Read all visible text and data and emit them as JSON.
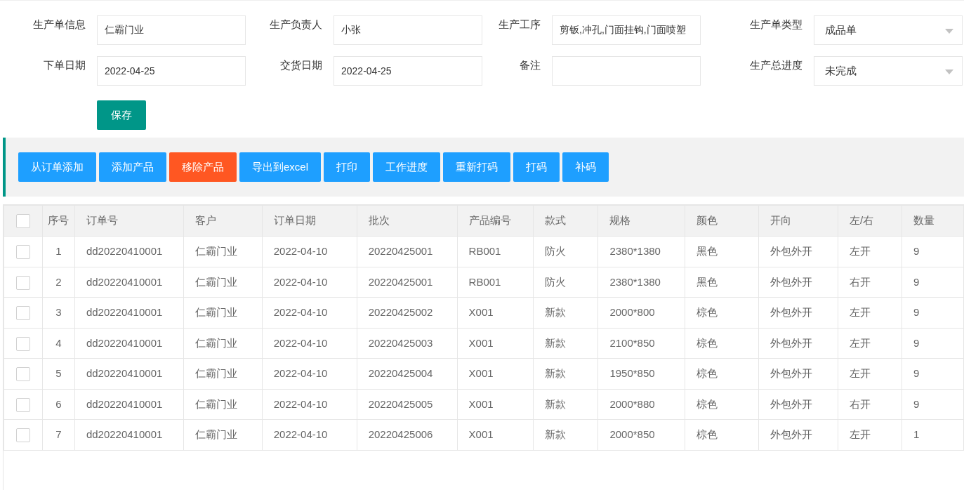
{
  "form": {
    "fields": [
      {
        "label": "生产单信息",
        "kind": "text",
        "value": "仁霸门业"
      },
      {
        "label": "生产负责人",
        "kind": "text",
        "value": "小张"
      },
      {
        "label": "生产工序",
        "kind": "text",
        "value": "剪钣,冲孔,门面挂钩,门面喷塑"
      },
      {
        "label": "生产单类型",
        "kind": "select",
        "value": "成品单"
      },
      {
        "label": "下单日期",
        "kind": "text",
        "value": "2022-04-25"
      },
      {
        "label": "交货日期",
        "kind": "text",
        "value": "2022-04-25"
      },
      {
        "label": "备注",
        "kind": "text"
      },
      {
        "label": "生产总进度",
        "kind": "select",
        "value": "未完成"
      }
    ],
    "save_button": "保存"
  },
  "toolbar": [
    {
      "label": "从订单添加",
      "kind": "normal"
    },
    {
      "label": "添加产品",
      "kind": "normal"
    },
    {
      "label": "移除产品",
      "kind": "danger"
    },
    {
      "label": "导出到excel",
      "kind": "normal"
    },
    {
      "label": "打印",
      "kind": "normal"
    },
    {
      "label": "工作进度",
      "kind": "normal"
    },
    {
      "label": "重新打码",
      "kind": "normal"
    },
    {
      "label": "打码",
      "kind": "normal"
    },
    {
      "label": "补码",
      "kind": "normal"
    }
  ],
  "table": {
    "select_all_checked": false,
    "columns": [
      "序号",
      "订单号",
      "客户",
      "订单日期",
      "批次",
      "产品编号",
      "款式",
      "规格",
      "颜色",
      "开向",
      "左/右",
      "数量"
    ],
    "rows": [
      {
        "checked": false,
        "cells": [
          "1",
          "dd20220410001",
          "仁霸门业",
          "2022-04-10",
          "20220425001",
          "RB001",
          "防火",
          "2380*1380",
          "黑色",
          "外包外开",
          "左开",
          "9"
        ]
      },
      {
        "checked": false,
        "cells": [
          "2",
          "dd20220410001",
          "仁霸门业",
          "2022-04-10",
          "20220425001",
          "RB001",
          "防火",
          "2380*1380",
          "黑色",
          "外包外开",
          "右开",
          "9"
        ]
      },
      {
        "checked": false,
        "cells": [
          "3",
          "dd20220410001",
          "仁霸门业",
          "2022-04-10",
          "20220425002",
          "X001",
          "新款",
          "2000*800",
          "棕色",
          "外包外开",
          "左开",
          "9"
        ]
      },
      {
        "checked": false,
        "cells": [
          "4",
          "dd20220410001",
          "仁霸门业",
          "2022-04-10",
          "20220425003",
          "X001",
          "新款",
          "2100*850",
          "棕色",
          "外包外开",
          "左开",
          "9"
        ]
      },
      {
        "checked": false,
        "cells": [
          "5",
          "dd20220410001",
          "仁霸门业",
          "2022-04-10",
          "20220425004",
          "X001",
          "新款",
          "1950*850",
          "棕色",
          "外包外开",
          "左开",
          "9"
        ]
      },
      {
        "checked": false,
        "cells": [
          "6",
          "dd20220410001",
          "仁霸门业",
          "2022-04-10",
          "20220425005",
          "X001",
          "新款",
          "2000*880",
          "棕色",
          "外包外开",
          "右开",
          "9"
        ]
      },
      {
        "checked": false,
        "cells": [
          "7",
          "dd20220410001",
          "仁霸门业",
          "2022-04-10",
          "20220425006",
          "X001",
          "新款",
          "2000*850",
          "棕色",
          "外包外开",
          "左开",
          "1"
        ]
      }
    ]
  }
}
